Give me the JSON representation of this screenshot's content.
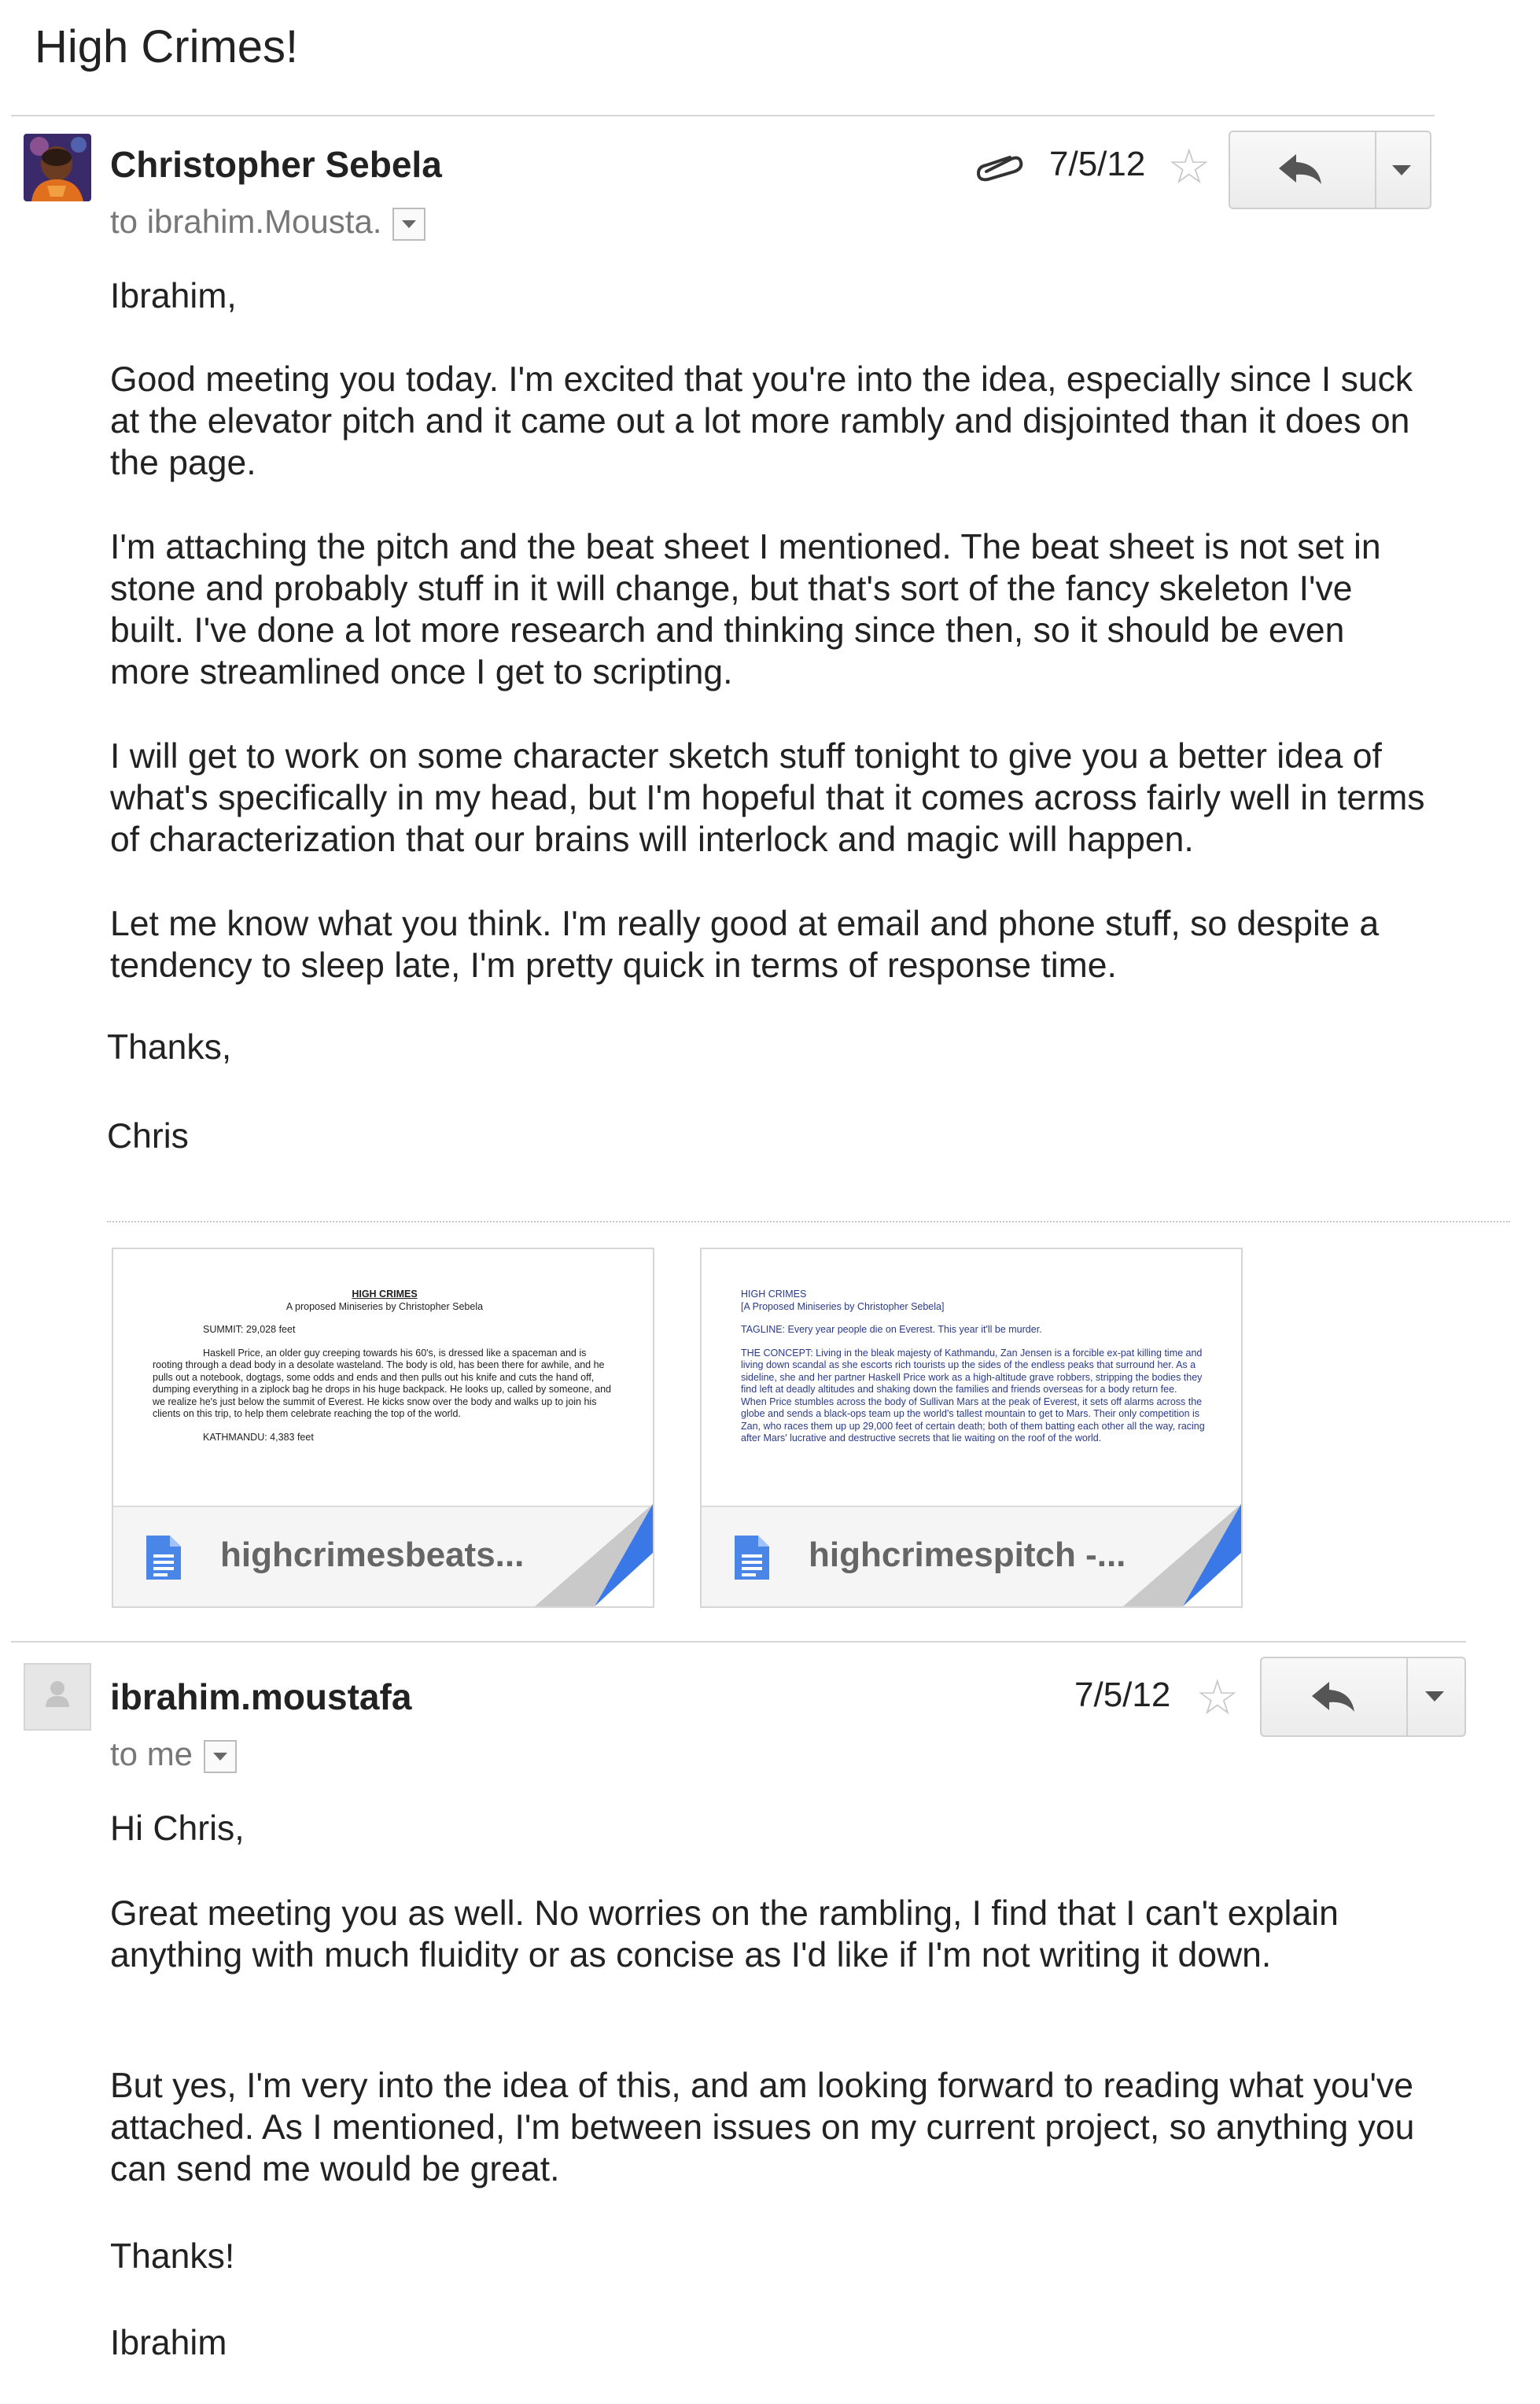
{
  "subject": "High Crimes!",
  "messages": [
    {
      "sender": "Christopher Sebela",
      "to_line": "to ibrahim.Mousta.",
      "date": "7/5/12",
      "has_attachment": true,
      "body": [
        "Ibrahim,",
        "Good meeting you today. I'm excited that you're into the idea, especially since I suck at the elevator pitch and it came out a lot more rambly and disjointed than it does on the page.",
        "I'm attaching the pitch and the beat sheet I mentioned. The beat sheet is not set in stone and probably stuff in it will change, but that's sort of the fancy skeleton I've built. I've done a lot more research and thinking since then, so it should be even more streamlined once I get to scripting.",
        "I will get to work on some character sketch stuff tonight to give you a better idea of what's specifically in my head, but I'm hopeful that it comes across fairly well in terms of characterization that our brains will interlock and magic will happen.",
        "Let me know what you think. I'm really good at email and phone stuff, so despite a tendency to sleep late, I'm pretty quick in terms of response time.",
        "Thanks,",
        "Chris"
      ],
      "attachments": [
        {
          "filename": "highcrimesbeats...",
          "preview": {
            "title": "HIGH CRIMES",
            "subtitle": "A proposed Miniseries by Christopher Sebela",
            "heading": "SUMMIT: 29,028 feet",
            "para": "Haskell Price, an older guy creeping towards his 60's, is dressed like a spaceman and is rooting through a dead body in a desolate wasteland. The body is old, has been there for awhile, and he pulls out a notebook, dogtags, some odds and ends and then pulls out his knife and cuts the hand off, dumping everything in a ziplock bag he drops in his huge backpack. He looks up, called by someone, and we realize he's just below the summit of Everest. He kicks snow over the body and walks up to join his clients on this trip, to help them celebrate reaching the top of the world.",
            "footer": "KATHMANDU: 4,383 feet"
          }
        },
        {
          "filename": "highcrimespitch -...",
          "preview": {
            "title": "HIGH CRIMES",
            "subtitle": "[A Proposed Miniseries by Christopher Sebela]",
            "tagline": "TAGLINE: Every year people die on Everest. This year it'll be murder.",
            "para": "THE CONCEPT: Living in the bleak majesty of Kathmandu, Zan Jensen is a forcible ex-pat killing time and living down scandal as she escorts rich tourists up the sides of the endless peaks that surround her. As a sideline, she and her partner Haskell Price work as a high-altitude grave robbers, stripping the bodies they find left at deadly altitudes and shaking down the families and friends overseas for a body return fee. When Price stumbles across the body of Sullivan Mars at the peak of Everest, it sets off alarms across the globe and sends a black-ops team up the world's tallest mountain to get to Mars. Their only competition is Zan, who races them up up 29,000 feet of certain death; both of them batting each other all the way, racing after Mars' lucrative and destructive secrets that lie waiting on the roof of the world."
          }
        }
      ]
    },
    {
      "sender": "ibrahim.moustafa",
      "to_line": "to me",
      "date": "7/5/12",
      "body": [
        "Hi Chris,",
        "Great meeting you as well.  No worries on the rambling, I find that I can't explain anything with much fluidity or as concise as I'd like if I'm not writing it down.",
        "But yes, I'm very into the idea of this, and am looking forward to reading what you've attached.  As I mentioned, I'm between issues on my current project, so anything you can send me would be great.",
        "Thanks!",
        "Ibrahim"
      ]
    }
  ],
  "colors": {
    "doc_icon_blue": "#4a86e8",
    "fold_blue": "#3b78e7",
    "star_empty": "#c8c8c8"
  }
}
